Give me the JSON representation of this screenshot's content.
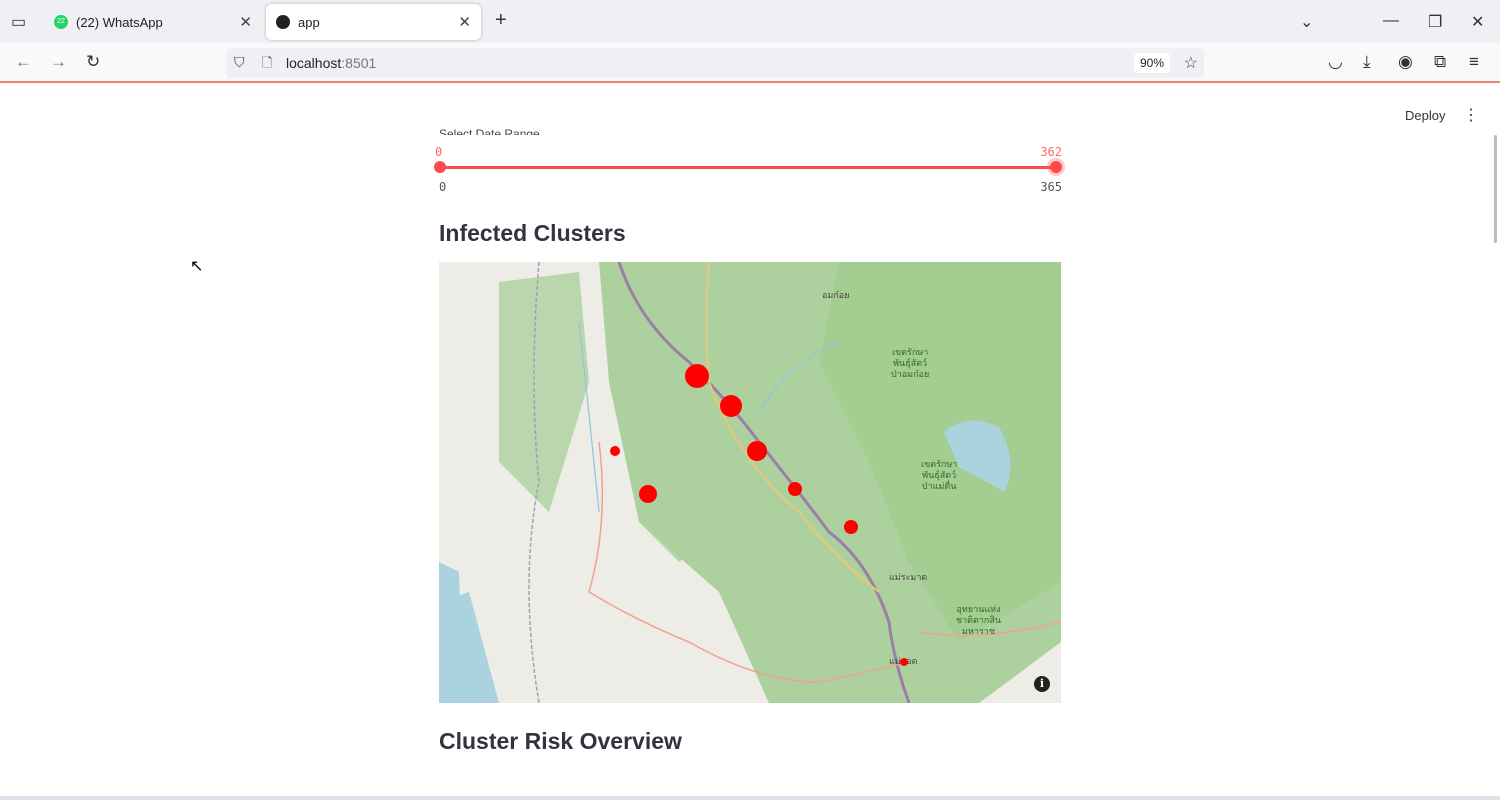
{
  "browser": {
    "tabs": [
      {
        "label": "(22) WhatsApp",
        "badge": "22"
      },
      {
        "label": "app"
      }
    ],
    "url_host": "localhost",
    "url_port": ":8501",
    "zoom": "90%"
  },
  "app": {
    "deploy_label": "Deploy",
    "slider": {
      "label": "Select Date Range",
      "low": 0,
      "high": 362,
      "min": 0,
      "max": 365
    },
    "section1": "Infected Clusters",
    "section2": "Cluster Risk Overview",
    "map_labels": {
      "omkoi": "อมก๋อย",
      "sanctuary1": "เขตรักษา\nพันธุ์สัตว์\nป่าอมก๋อย",
      "sanctuary2": "เขตรักษา\nพันธุ์สัตว์\nป่าแม่ตื่น",
      "maesariang": "แม่ระมาด",
      "park1": "อุทยานแห่ง\nชาติตากสิน\nมหาราช",
      "maesot": "แม่สอด"
    },
    "marker_color": "#ff0000"
  }
}
